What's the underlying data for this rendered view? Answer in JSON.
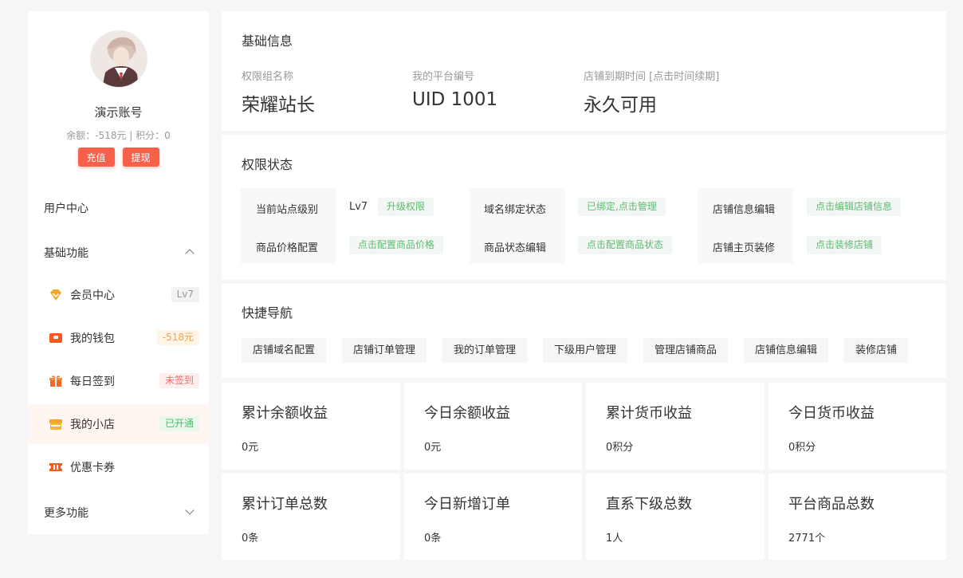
{
  "user": {
    "name": "演示账号",
    "balance_line": "余额：-518元 | 积分：0",
    "recharge_label": "充值",
    "withdraw_label": "提现"
  },
  "sidebar": {
    "user_center": "用户中心",
    "basic_group": "基础功能",
    "more_group": "更多功能",
    "items": [
      {
        "label": "会员中心",
        "tag": "Lv7",
        "icon": "diamond-icon"
      },
      {
        "label": "我的钱包",
        "tag": "-518元",
        "icon": "wallet-icon"
      },
      {
        "label": "每日签到",
        "tag": "未签到",
        "icon": "gift-icon"
      },
      {
        "label": "我的小店",
        "tag": "已开通",
        "icon": "shop-icon"
      },
      {
        "label": "优惠卡券",
        "tag": "",
        "icon": "coupon-icon"
      }
    ]
  },
  "basic_info": {
    "title": "基础信息",
    "fields": [
      {
        "label": "权限组名称",
        "value": "荣耀站长"
      },
      {
        "label": "我的平台编号",
        "value": "UID 1001"
      },
      {
        "label": "店铺到期时间 [点击时间续期]",
        "value": "永久可用"
      }
    ]
  },
  "permissions": {
    "title": "权限状态",
    "site_level_label": "当前站点级别",
    "site_level_value": "Lv7",
    "upgrade": "升级权限",
    "domain_label": "域名绑定状态",
    "domain_action": "已绑定,点击管理",
    "shop_info_label": "店铺信息编辑",
    "shop_info_action": "点击编辑店铺信息",
    "price_label": "商品价格配置",
    "price_action": "点击配置商品价格",
    "status_label": "商品状态编辑",
    "status_action": "点击配置商品状态",
    "decorate_label": "店铺主页装修",
    "decorate_action": "点击装修店铺"
  },
  "quick_nav": {
    "title": "快捷导航",
    "items": [
      "店铺域名配置",
      "店铺订单管理",
      "我的订单管理",
      "下级用户管理",
      "管理店铺商品",
      "店铺信息编辑",
      "装修店铺"
    ]
  },
  "stats": [
    {
      "title": "累计余额收益",
      "value": "0元"
    },
    {
      "title": "今日余额收益",
      "value": "0元"
    },
    {
      "title": "累计货币收益",
      "value": "0积分"
    },
    {
      "title": "今日货币收益",
      "value": "0积分"
    },
    {
      "title": "累计订单总数",
      "value": "0条"
    },
    {
      "title": "今日新增订单",
      "value": "0条"
    },
    {
      "title": "直系下级总数",
      "value": "1人"
    },
    {
      "title": "平台商品总数",
      "value": "2771个"
    }
  ]
}
